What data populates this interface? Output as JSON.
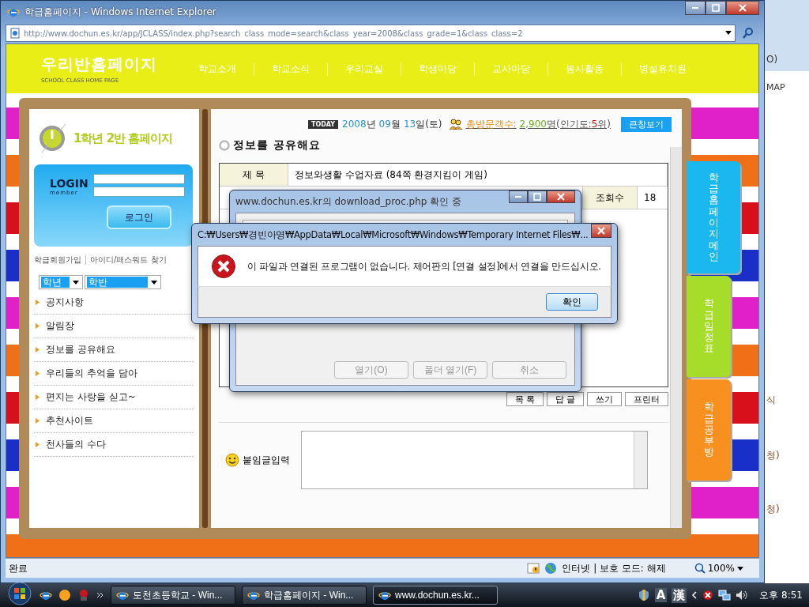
{
  "window": {
    "title": "학급홈페이지 - Windows Internet Explorer",
    "address": "http://www.dochun.es.kr/app/JCLASS/index.php?search_class_mode=search&class_year=2008&class_grade=1&class_class=2"
  },
  "site": {
    "title": "우리반홈페이지",
    "subtitle": "SCHOOL CLASS HOME PAGE",
    "nav": [
      "학교소개",
      "학교소식",
      "우리교실",
      "학생마당",
      "교사마당",
      "봉사활동",
      "병설유치원"
    ]
  },
  "sidebar": {
    "class_title": "1학년 2반 홈페이지",
    "login_label": "LOGIN",
    "login_sublabel": "member",
    "login_button": "로그인",
    "links": [
      "학급회원가입",
      "아이디/패스워드 찾기"
    ],
    "selects": [
      "학년",
      "학반"
    ],
    "menu": [
      "공지사항",
      "알림장",
      "정보를 공유해요",
      "우리들의 추억을 담아",
      "편지는 사랑을 싣고~",
      "추천사이트",
      "천사들의 수다"
    ]
  },
  "info_bar": {
    "today": "TODAY",
    "date": [
      {
        "text": "2008",
        "kind": "number"
      },
      {
        "text": "년",
        "kind": "unit"
      },
      {
        "text": "09",
        "kind": "number"
      },
      {
        "text": "월",
        "kind": "unit"
      },
      {
        "text": "13",
        "kind": "number"
      },
      {
        "text": "일(토)",
        "kind": "unit"
      }
    ],
    "visitors": [
      {
        "text": "총방문객수:",
        "kind": "label"
      },
      {
        "text": "2,900",
        "kind": "count"
      },
      {
        "text": "명(인기도:",
        "kind": "plain"
      },
      {
        "text": "5",
        "kind": "rank"
      },
      {
        "text": "위)",
        "kind": "plain"
      }
    ],
    "big_view_button": "큰창보기"
  },
  "board": {
    "title": "정보를 공유해요",
    "subject_label": "제 목",
    "subject": "정보와생활 수업자료 (84쪽 환경지킴이 게임)",
    "views_label": "조회수",
    "views": "18",
    "buttons": [
      "목 록",
      "답 글",
      "쓰기",
      "프린터"
    ],
    "comment_label": "붙임글입력"
  },
  "side_tabs": [
    {
      "label": "학급홈페이지메인",
      "color": "#1ab8ee"
    },
    {
      "label": "학급일정표",
      "color": "#a6dc2a"
    },
    {
      "label": "학급공부방",
      "color": "#f7901e"
    }
  ],
  "background_window": {
    "fragments": [
      "O)",
      "MAP",
      "식",
      "청)",
      "청)"
    ]
  },
  "status_bar": {
    "text": "완료",
    "zone": "인터넷 | 보호 모드: 해제",
    "zoom": "100%"
  },
  "download_dialog": {
    "title": "www.dochun.es.kr의 download_proc.php 확인 중",
    "buttons": [
      {
        "label": "열기(O)",
        "disabled": true
      },
      {
        "label": "폴더 열기(F)",
        "disabled": true
      },
      {
        "label": "취소",
        "disabled": true
      }
    ]
  },
  "error_dialog": {
    "title": "C:₩Users₩경빈아영₩AppData₩Local₩Microsoft₩Windows₩Temporary Internet Files₩...",
    "message": "이 파일과 연결된 프로그램이 없습니다. 제어판의 [연결 설정]에서 연결을 만드십시오.",
    "button": "확인"
  },
  "taskbar": {
    "tasks": [
      {
        "label": "도천초등학교 - Win...",
        "selected": false
      },
      {
        "label": "학급홈페이지 - Win...",
        "selected": false
      },
      {
        "label": "www.dochun.es.kr...",
        "selected": true
      }
    ],
    "ime": [
      "A",
      "漢"
    ],
    "clock": "오후 8:51"
  }
}
